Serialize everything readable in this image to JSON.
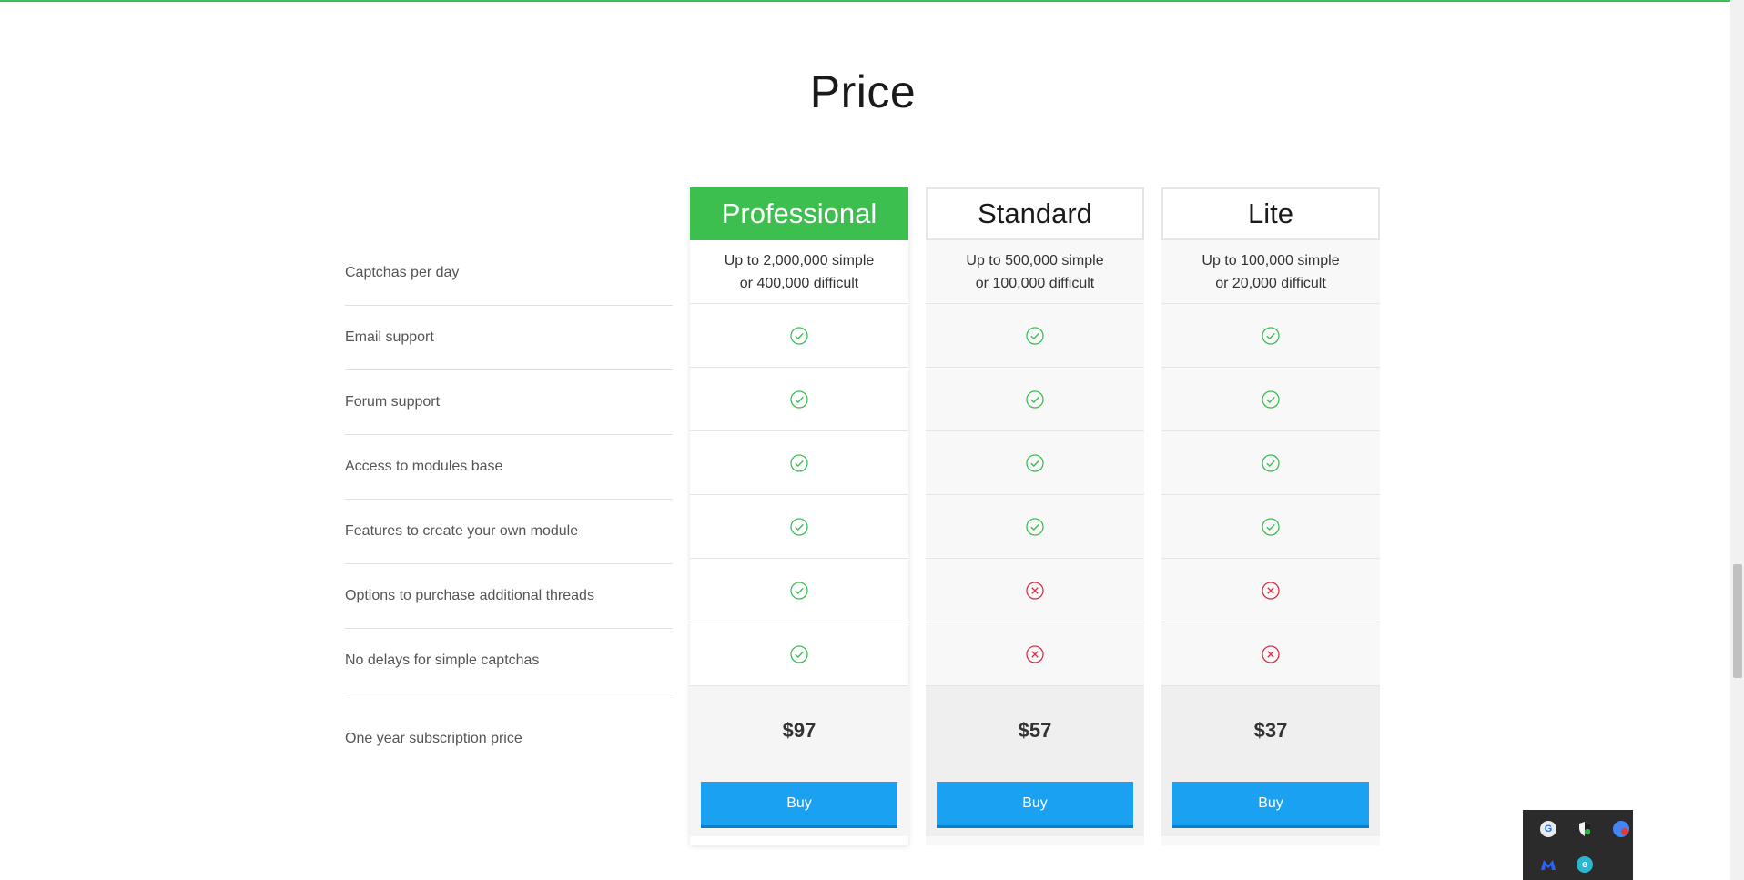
{
  "title": "Price",
  "features": [
    "Captchas per day",
    "Email support",
    "Forum support",
    "Access to modules base",
    "Features to create your own module",
    "Options to purchase additional threads",
    "No delays for simple captchas",
    "One year subscription price"
  ],
  "plans": [
    {
      "name": "Professional",
      "captchas_line1": "Up to 2,000,000 simple",
      "captchas_line2": "or 400,000 difficult",
      "features": [
        true,
        true,
        true,
        true,
        true,
        true
      ],
      "price": "$97",
      "buy_label": "Buy",
      "accent": "#3cbf4e"
    },
    {
      "name": "Standard",
      "captchas_line1": "Up to 500,000 simple",
      "captchas_line2": "or 100,000 difficult",
      "features": [
        true,
        true,
        true,
        true,
        false,
        false
      ],
      "price": "$57",
      "buy_label": "Buy"
    },
    {
      "name": "Lite",
      "captchas_line1": "Up to 100,000 simple",
      "captchas_line2": "or 20,000 difficult",
      "features": [
        true,
        true,
        true,
        true,
        false,
        false
      ],
      "price": "$37",
      "buy_label": "Buy"
    }
  ],
  "colors": {
    "check": "#3cbf57",
    "cross": "#d9334a",
    "buy_button": "#1ba1f2"
  },
  "icons": {
    "included": "check-circle-icon",
    "excluded": "x-circle-icon"
  },
  "tray": {
    "icons": [
      "google-icon",
      "shield-icon",
      "chrome-badge-icon",
      "malwarebytes-icon",
      "edge-icon"
    ]
  }
}
